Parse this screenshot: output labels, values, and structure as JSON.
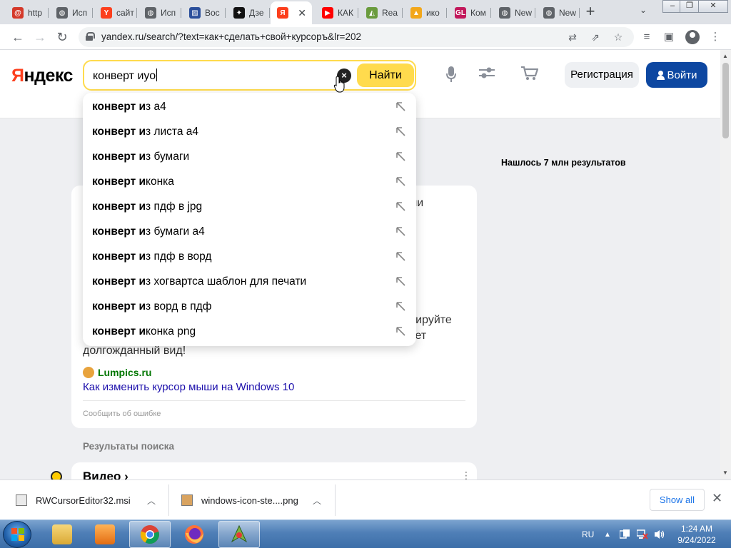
{
  "browser": {
    "tabs": [
      {
        "label": "http",
        "color": "#d4392a",
        "glyph": "@"
      },
      {
        "label": "Исп",
        "color": "#5f6368",
        "glyph": "◍"
      },
      {
        "label": "сайт",
        "color": "#fc3f1d",
        "glyph": "Y"
      },
      {
        "label": "Исп",
        "color": "#5f6368",
        "glyph": "◍"
      },
      {
        "label": "Вос",
        "color": "#2b4f9b",
        "glyph": "▨"
      },
      {
        "label": "Дзе",
        "color": "#111111",
        "glyph": "✦"
      },
      {
        "label": "",
        "color": "#fc3f1d",
        "glyph": "Я",
        "active": true
      },
      {
        "label": "КАК",
        "color": "#ff0000",
        "glyph": "▶"
      },
      {
        "label": "Rea",
        "color": "#6a9b3d",
        "glyph": "◭"
      },
      {
        "label": "ико",
        "color": "#f2a71b",
        "glyph": "▲"
      },
      {
        "label": "Ком",
        "color": "#c2185b",
        "glyph": "GL"
      },
      {
        "label": "New",
        "color": "#5f6368",
        "glyph": "◍"
      },
      {
        "label": "New",
        "color": "#5f6368",
        "glyph": "◍"
      }
    ],
    "new_tab_icon": "plus-icon",
    "url": "yandex.ru/search/?text=как+сделать+свой+курсоръ&lr=202"
  },
  "header": {
    "logo_first": "Я",
    "logo_rest": "ндекс",
    "query": "конверт иуо",
    "find_label": "Найти",
    "register_label": "Регистрация",
    "login_label": "Войти"
  },
  "suggest": {
    "items": [
      {
        "bold": "конверт и",
        "rest": "з а4"
      },
      {
        "bold": "конверт и",
        "rest": "з листа а4"
      },
      {
        "bold": "конверт и",
        "rest": "з бумаги"
      },
      {
        "bold": "конверт и",
        "rest": "конка"
      },
      {
        "bold": "конверт и",
        "rest": "з пдф в jpg"
      },
      {
        "bold": "конверт и",
        "rest": "з бумаги а4"
      },
      {
        "bold": "конверт и",
        "rest": "з пдф в ворд"
      },
      {
        "bold": "конверт и",
        "rest": "з хогвартса шаблон для печати"
      },
      {
        "bold": "конверт и",
        "rest": "з ворд в пдф"
      },
      {
        "bold": "конверт и",
        "rest": "конка png"
      }
    ]
  },
  "results": {
    "found_text": "Нашлось 7 млн результатов",
    "fragment_1": "или",
    "fragment_2": "нтируйте",
    "fragment_3": "етет",
    "snippet_tail": "долгожданный вид!",
    "source": "Lumpics.ru",
    "link": "Как изменить курсор мыши на Windows 10",
    "report": "Сообщить об ошибке",
    "section_header": "Результаты поиска",
    "video_title": "Видео ›",
    "video_more": "⋮"
  },
  "downloads": {
    "items": [
      {
        "name": "RWCursorEditor32.msi"
      },
      {
        "name": "windows-icon-ste....png"
      }
    ],
    "show_all": "Show all"
  },
  "taskbar": {
    "lang": "RU",
    "time": "1:24 AM",
    "date": "9/24/2022"
  }
}
